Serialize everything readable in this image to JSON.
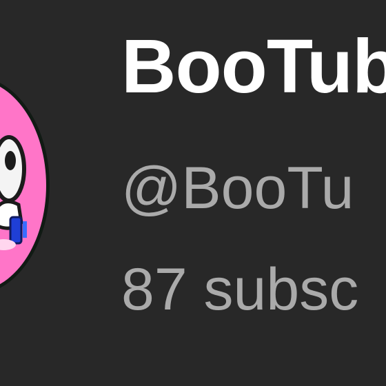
{
  "channel": {
    "name": "BooTub",
    "handle": "@BooTu",
    "subscribers": "87 subsc"
  },
  "avatar": {
    "icon": "boo-ghost-avatar-icon",
    "background_color": "#ff75c8"
  },
  "colors": {
    "page_background": "#282828",
    "name_text": "#ffffff",
    "secondary_text": "#aaaaaa"
  }
}
